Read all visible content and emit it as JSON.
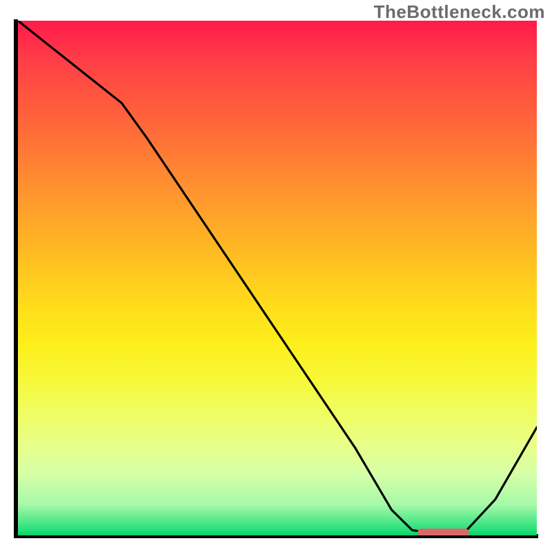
{
  "watermark": "TheBottleneck.com",
  "chart_data": {
    "type": "line",
    "title": "",
    "xlabel": "",
    "ylabel": "",
    "xlim": [
      0,
      100
    ],
    "ylim": [
      0,
      100
    ],
    "x": [
      0,
      10,
      20,
      25,
      35,
      45,
      55,
      65,
      72,
      76,
      80,
      86,
      92,
      100
    ],
    "values": [
      100,
      92,
      84,
      77,
      62,
      47,
      32,
      17,
      5,
      1,
      0.5,
      0.5,
      7,
      21
    ],
    "optimum_marker": {
      "x_start": 77,
      "x_end": 87,
      "y": 0.5
    },
    "colors": {
      "curve": "#000000",
      "marker": "#d86a6a",
      "gradient_top": "#ff1a4b",
      "gradient_bottom": "#07d169"
    }
  }
}
